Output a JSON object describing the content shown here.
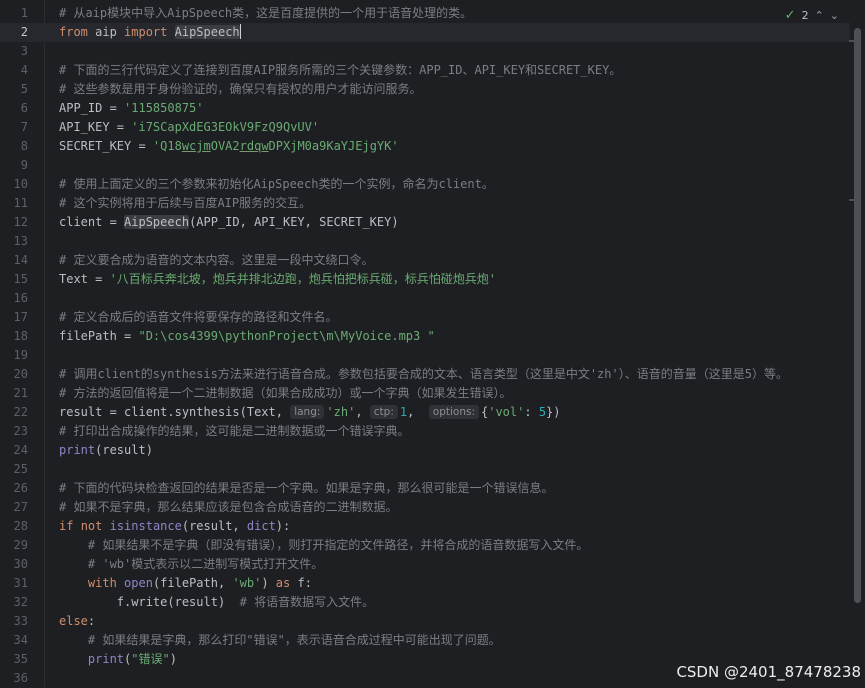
{
  "editor": {
    "current_line": 2,
    "inspection": {
      "count": "2",
      "check_glyph": "✓",
      "up_glyph": "⌃",
      "down_glyph": "⌄"
    },
    "colors": {
      "background": "#1e1f22",
      "comment": "#7a7e85",
      "keyword": "#cf8e6d",
      "string": "#6aab73",
      "number": "#2aacb8",
      "default": "#bcbec4"
    },
    "lines": [
      {
        "n": "1",
        "segs": [
          {
            "t": "# 从aip模块中导入AipSpeech类，这是百度提供的一个用于语音处理的类。",
            "c": "cmt"
          }
        ]
      },
      {
        "n": "2",
        "segs": [
          {
            "t": "from",
            "c": "kw"
          },
          {
            "t": " aip "
          },
          {
            "t": "import",
            "c": "kw"
          },
          {
            "t": " "
          },
          {
            "t": "AipSpeech",
            "c": "hl"
          },
          {
            "caret": true
          }
        ]
      },
      {
        "n": "3",
        "segs": []
      },
      {
        "n": "4",
        "segs": [
          {
            "t": "# 下面的三行代码定义了连接到百度AIP服务所需的三个关键参数：APP_ID、API_KEY和SECRET_KEY。",
            "c": "cmt"
          }
        ]
      },
      {
        "n": "5",
        "segs": [
          {
            "t": "# 这些参数是用于身份验证的，确保只有授权的用户才能访问服务。",
            "c": "cmt"
          }
        ]
      },
      {
        "n": "6",
        "segs": [
          {
            "t": "APP_ID = "
          },
          {
            "t": "'115850875'",
            "c": "str"
          }
        ]
      },
      {
        "n": "7",
        "segs": [
          {
            "t": "API_KEY = "
          },
          {
            "t": "'i7SCapXdEG3EOkV9FzQ9QvUV'",
            "c": "str"
          }
        ]
      },
      {
        "n": "8",
        "segs": [
          {
            "t": "SECRET_KEY = "
          },
          {
            "t": "'Q18",
            "c": "str"
          },
          {
            "t": "wcjm",
            "c": "str ul"
          },
          {
            "t": "OVA2",
            "c": "str"
          },
          {
            "t": "rdqw",
            "c": "str ul"
          },
          {
            "t": "DPXjM0a9KaYJEjgYK'",
            "c": "str"
          }
        ]
      },
      {
        "n": "9",
        "segs": []
      },
      {
        "n": "10",
        "segs": [
          {
            "t": "# 使用上面定义的三个参数来初始化AipSpeech类的一个实例，命名为client。",
            "c": "cmt"
          }
        ]
      },
      {
        "n": "11",
        "segs": [
          {
            "t": "# 这个实例将用于后续与百度AIP服务的交互。",
            "c": "cmt"
          }
        ]
      },
      {
        "n": "12",
        "segs": [
          {
            "t": "client = "
          },
          {
            "t": "AipSpeech",
            "c": "hl"
          },
          {
            "t": "(APP_ID, API_KEY, SECRET_KEY)"
          }
        ]
      },
      {
        "n": "13",
        "segs": []
      },
      {
        "n": "14",
        "segs": [
          {
            "t": "# 定义要合成为语音的文本内容。这里是一段中文绕口令。",
            "c": "cmt"
          }
        ]
      },
      {
        "n": "15",
        "segs": [
          {
            "t": "Text = "
          },
          {
            "t": "'八百标兵奔北坡，炮兵并排北边跑，炮兵怕把标兵碰，标兵怕碰炮兵炮'",
            "c": "str"
          }
        ]
      },
      {
        "n": "16",
        "segs": []
      },
      {
        "n": "17",
        "segs": [
          {
            "t": "# 定义合成后的语音文件将要保存的路径和文件名。",
            "c": "cmt"
          }
        ]
      },
      {
        "n": "18",
        "segs": [
          {
            "t": "filePath = "
          },
          {
            "t": "\"D:\\cos4399\\pythonProject\\m\\MyVoice.mp3 \"",
            "c": "str"
          }
        ]
      },
      {
        "n": "19",
        "segs": []
      },
      {
        "n": "20",
        "segs": [
          {
            "t": "# 调用client的synthesis方法来进行语音合成。参数包括要合成的文本、语言类型（这里是中文'zh'）、语音的音量（这里是5）等。",
            "c": "cmt"
          }
        ]
      },
      {
        "n": "21",
        "segs": [
          {
            "t": "# 方法的返回值将是一个二进制数据（如果合成成功）或一个字典（如果发生错误）。",
            "c": "cmt"
          }
        ]
      },
      {
        "n": "22",
        "segs": [
          {
            "t": "result = client.synthesis(Text, "
          },
          {
            "hint": "lang:"
          },
          {
            "t": "'zh'",
            "c": "str"
          },
          {
            "t": ", "
          },
          {
            "hint": "ctp:"
          },
          {
            "t": "1",
            "c": "num"
          },
          {
            "t": ",  "
          },
          {
            "hint": "options:"
          },
          {
            "t": "{"
          },
          {
            "t": "'vol'",
            "c": "str"
          },
          {
            "t": ": "
          },
          {
            "t": "5",
            "c": "num"
          },
          {
            "t": "})"
          }
        ]
      },
      {
        "n": "23",
        "segs": [
          {
            "t": "# 打印出合成操作的结果，这可能是二进制数据或一个错误字典。",
            "c": "cmt"
          }
        ]
      },
      {
        "n": "24",
        "segs": [
          {
            "t": "print",
            "c": "bi"
          },
          {
            "t": "(result)"
          }
        ]
      },
      {
        "n": "25",
        "segs": []
      },
      {
        "n": "26",
        "segs": [
          {
            "t": "# 下面的代码块检查返回的结果是否是一个字典。如果是字典，那么很可能是一个错误信息。",
            "c": "cmt"
          }
        ]
      },
      {
        "n": "27",
        "segs": [
          {
            "t": "# 如果不是字典，那么结果应该是包含合成语音的二进制数据。",
            "c": "cmt"
          }
        ]
      },
      {
        "n": "28",
        "segs": [
          {
            "t": "if",
            "c": "kw"
          },
          {
            "t": " "
          },
          {
            "t": "not",
            "c": "kw"
          },
          {
            "t": " "
          },
          {
            "t": "isinstance",
            "c": "bi"
          },
          {
            "t": "(result, "
          },
          {
            "t": "dict",
            "c": "bi"
          },
          {
            "t": "):"
          }
        ]
      },
      {
        "n": "29",
        "segs": [
          {
            "t": "    "
          },
          {
            "t": "# 如果结果不是字典（即没有错误），则打开指定的文件路径，并将合成的语音数据写入文件。",
            "c": "cmt"
          }
        ]
      },
      {
        "n": "30",
        "segs": [
          {
            "t": "    "
          },
          {
            "t": "# 'wb'模式表示以二进制写模式打开文件。",
            "c": "cmt"
          }
        ]
      },
      {
        "n": "31",
        "segs": [
          {
            "t": "    "
          },
          {
            "t": "with",
            "c": "kw"
          },
          {
            "t": " "
          },
          {
            "t": "open",
            "c": "bi"
          },
          {
            "t": "(filePath, "
          },
          {
            "t": "'wb'",
            "c": "str"
          },
          {
            "t": ") "
          },
          {
            "t": "as",
            "c": "kw"
          },
          {
            "t": " f:"
          }
        ]
      },
      {
        "n": "32",
        "segs": [
          {
            "t": "        f.write(result)  "
          },
          {
            "t": "# 将语音数据写入文件。",
            "c": "cmt"
          }
        ]
      },
      {
        "n": "33",
        "segs": [
          {
            "t": "else",
            "c": "kw"
          },
          {
            "t": ":"
          }
        ]
      },
      {
        "n": "34",
        "segs": [
          {
            "t": "    "
          },
          {
            "t": "# 如果结果是字典，那么打印\"错误\"，表示语音合成过程中可能出现了问题。",
            "c": "cmt"
          }
        ]
      },
      {
        "n": "35",
        "segs": [
          {
            "t": "    "
          },
          {
            "t": "print",
            "c": "bi"
          },
          {
            "t": "("
          },
          {
            "t": "\"错误\"",
            "c": "str"
          },
          {
            "t": ")"
          }
        ]
      },
      {
        "n": "36",
        "segs": []
      }
    ]
  },
  "watermark": "CSDN @2401_87478238"
}
